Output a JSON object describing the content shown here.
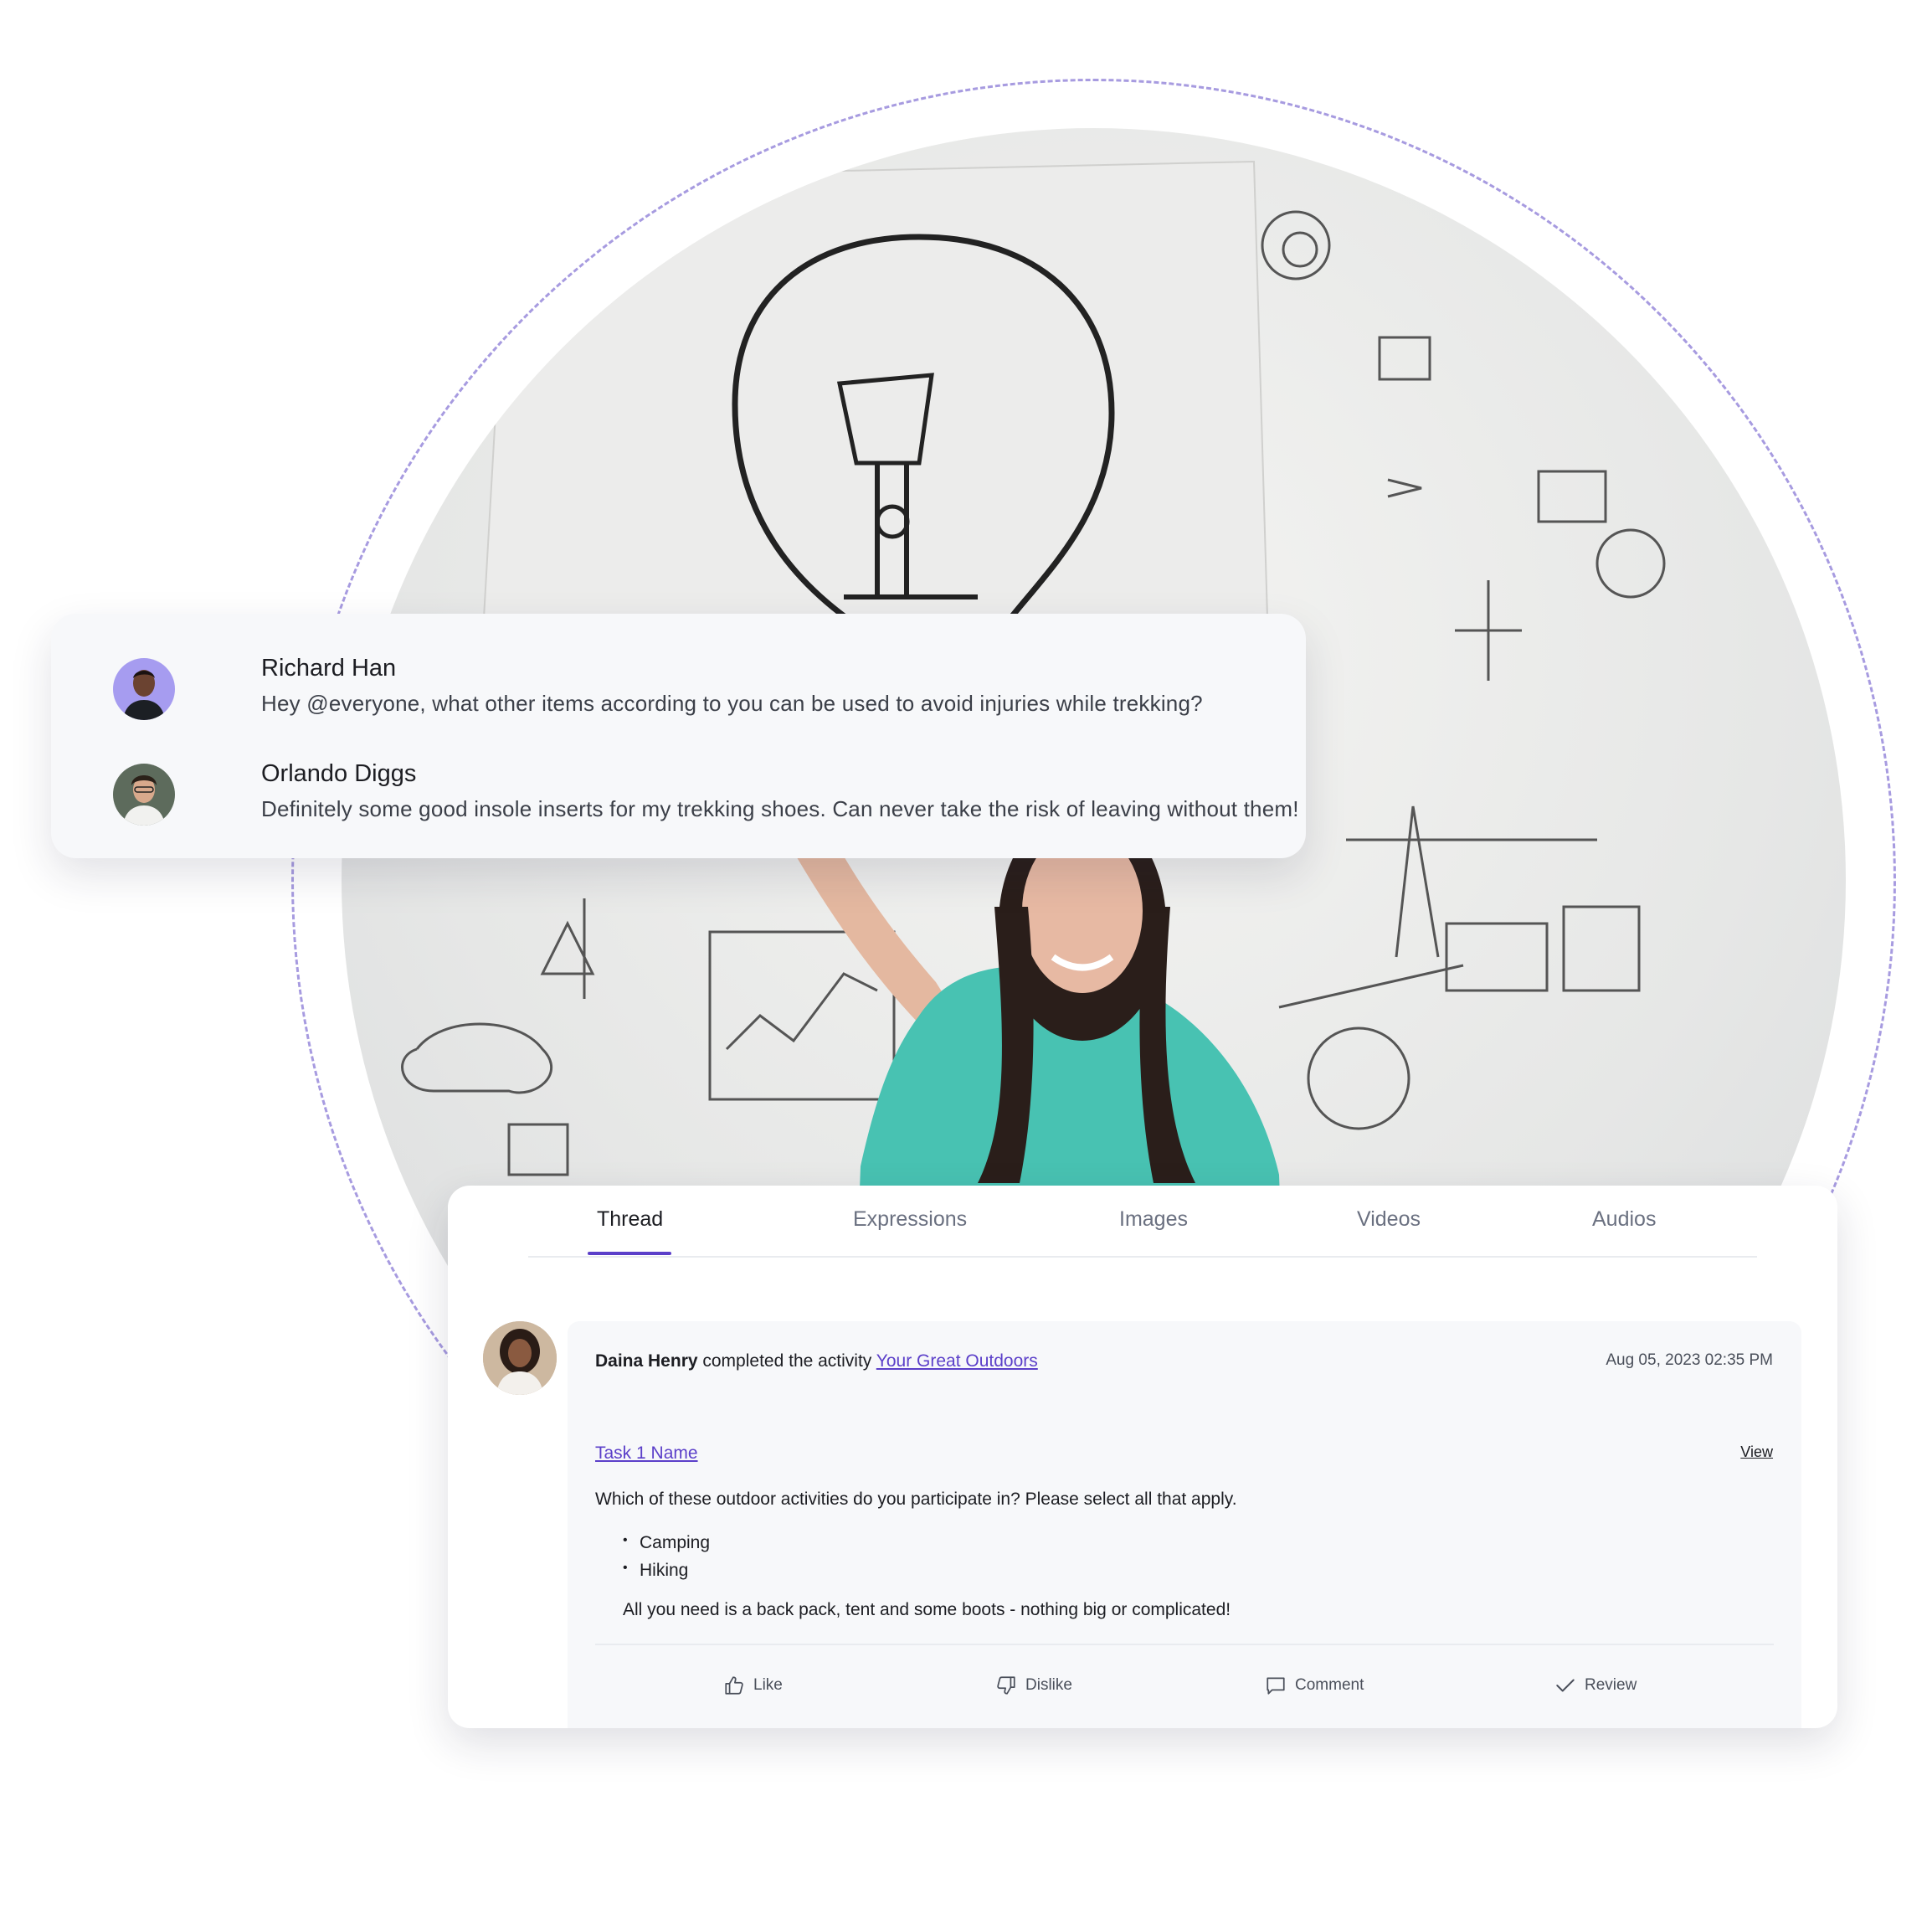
{
  "chat": {
    "messages": [
      {
        "name": "Richard Han",
        "text": "Hey @everyone, what other items according to you can be used to avoid injuries while trekking?"
      },
      {
        "name": "Orlando Diggs",
        "text": "Definitely some good insole inserts for my trekking shoes. Can never take the risk of leaving without them!"
      }
    ]
  },
  "tabs": [
    "Thread",
    "Expressions",
    "Images",
    "Videos",
    "Audios"
  ],
  "active_tab": "Thread",
  "post": {
    "author": "Daina Henry",
    "action_text": " completed the activity ",
    "activity_link": "Your Great Outdoors",
    "date": "Aug 05, 2023 02:35 PM",
    "task_link": "Task 1 Name",
    "view_label": "View",
    "question": "Which of these outdoor activities do you participate in? Please select all that apply.",
    "answers": [
      "Camping",
      "Hiking"
    ],
    "comment": "All you need is a back pack, tent and some boots - nothing big or complicated!"
  },
  "actions": {
    "like": "Like",
    "dislike": "Dislike",
    "comment": "Comment",
    "review": "Review"
  },
  "colors": {
    "accent": "#5b3fc9",
    "ring": "#a79be0",
    "card_bg": "#f7f8fa"
  },
  "icons": [
    "thumbs-up-icon",
    "thumbs-down-icon",
    "comment-icon",
    "check-icon"
  ]
}
